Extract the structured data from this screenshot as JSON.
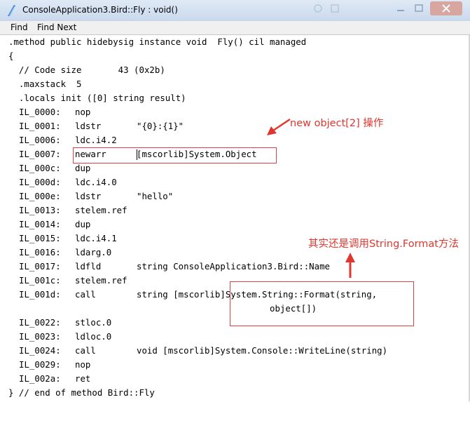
{
  "window": {
    "title": "ConsoleApplication3.Bird::Fly : void()"
  },
  "menu": {
    "items": [
      "Find",
      "Find Next"
    ]
  },
  "code": {
    "header": ".method public hidebysig instance void  Fly() cil managed",
    "open_brace": "{",
    "code_size": "  // Code size       43 (0x2b)",
    "maxstack": "  .maxstack  5",
    "locals": "  .locals init ([0] string result)",
    "instructions": [
      {
        "label": "IL_0000:",
        "op": "nop",
        "arg": ""
      },
      {
        "label": "IL_0001:",
        "op": "ldstr",
        "arg": "\"{0}:{1}\""
      },
      {
        "label": "IL_0006:",
        "op": "ldc.i4.2",
        "arg": ""
      },
      {
        "label": "IL_0007:",
        "op": "newarr",
        "arg": "[mscorlib]System.Object"
      },
      {
        "label": "IL_000c:",
        "op": "dup",
        "arg": ""
      },
      {
        "label": "IL_000d:",
        "op": "ldc.i4.0",
        "arg": ""
      },
      {
        "label": "IL_000e:",
        "op": "ldstr",
        "arg": "\"hello\""
      },
      {
        "label": "IL_0013:",
        "op": "stelem.ref",
        "arg": ""
      },
      {
        "label": "IL_0014:",
        "op": "dup",
        "arg": ""
      },
      {
        "label": "IL_0015:",
        "op": "ldc.i4.1",
        "arg": ""
      },
      {
        "label": "IL_0016:",
        "op": "ldarg.0",
        "arg": ""
      },
      {
        "label": "IL_0017:",
        "op": "ldfld",
        "arg": "string ConsoleApplication3.Bird::Name"
      },
      {
        "label": "IL_001c:",
        "op": "stelem.ref",
        "arg": ""
      },
      {
        "label": "IL_001d:",
        "op": "call",
        "arg": "string [mscorlib]System.String::Format(string,"
      },
      {
        "label": "",
        "op": "",
        "arg": "                                                  object[])"
      },
      {
        "label": "",
        "op": "",
        "arg": ""
      },
      {
        "label": "IL_0022:",
        "op": "stloc.0",
        "arg": ""
      },
      {
        "label": "IL_0023:",
        "op": "ldloc.0",
        "arg": ""
      },
      {
        "label": "IL_0024:",
        "op": "call",
        "arg": "void [mscorlib]System.Console::WriteLine(string)"
      },
      {
        "label": "IL_0029:",
        "op": "nop",
        "arg": ""
      },
      {
        "label": "IL_002a:",
        "op": "ret",
        "arg": ""
      }
    ],
    "footer": "} // end of method Bird::Fly"
  },
  "annotations": {
    "newarr_note": "new object[2] 操作",
    "format_note": "其实还是调用String.Format方法",
    "color": "#e0362e"
  }
}
